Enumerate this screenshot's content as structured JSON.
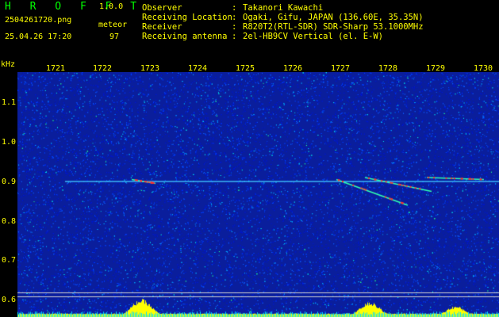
{
  "colors": {
    "background": "#000000",
    "text": "#ffffff",
    "highlight": "#ffff00",
    "accent": "#00ff00",
    "waterfall_base": "#0a1e9c",
    "signal": "#ff3030",
    "level_bar": "#ffff00"
  },
  "app": {
    "name": "H R O F F T",
    "version": "1.0.0",
    "file_name": "2504261720.png",
    "event_label": "meteor",
    "timestamp": "25.04.26 17:20",
    "event_count": "97"
  },
  "metadata": [
    {
      "label": "Observer",
      "value": "Takanori Kawachi"
    },
    {
      "label": "Receiving Location",
      "value": "Ogaki, Gifu, JAPAN (136.60E, 35.35N)"
    },
    {
      "label": "Receiver",
      "value": "R820T2(RTL-SDR) SDR-Sharp 53.1000MHz"
    },
    {
      "label": "Receiving antenna",
      "value": "2el-HB9CV Vertical (el. E-W)"
    }
  ],
  "chart_data": {
    "type": "heatmap",
    "title": "",
    "xlabel": "",
    "ylabel": "kHz",
    "x_ticks": [
      "1721",
      "1722",
      "1723",
      "1724",
      "1725",
      "1726",
      "1727",
      "1728",
      "1729",
      "1730"
    ],
    "y_ticks": [
      "1.1",
      "1.0",
      "0.9",
      "0.8",
      "0.7",
      "0.6"
    ],
    "ylim": [
      0.58,
      1.19
    ],
    "carrier_khz": 0.9,
    "reference_lines_khz": [
      0.62,
      0.61
    ],
    "meteor_echoes": [
      {
        "time": [
          "1722.8",
          "1723.3"
        ],
        "khz": [
          0.905,
          0.895
        ]
      },
      {
        "time": [
          "1727.1",
          "1728.6"
        ],
        "khz": [
          0.905,
          0.84
        ]
      },
      {
        "time": [
          "1727.7",
          "1729.1"
        ],
        "khz": [
          0.91,
          0.875
        ]
      },
      {
        "time": [
          "1729.0",
          "1730.2"
        ],
        "khz": [
          0.91,
          0.905
        ]
      }
    ],
    "level_peaks": [
      {
        "time": "1723.0",
        "level": 0.9
      },
      {
        "time": "1727.8",
        "level": 0.75
      },
      {
        "time": "1729.6",
        "level": 0.55
      }
    ]
  }
}
